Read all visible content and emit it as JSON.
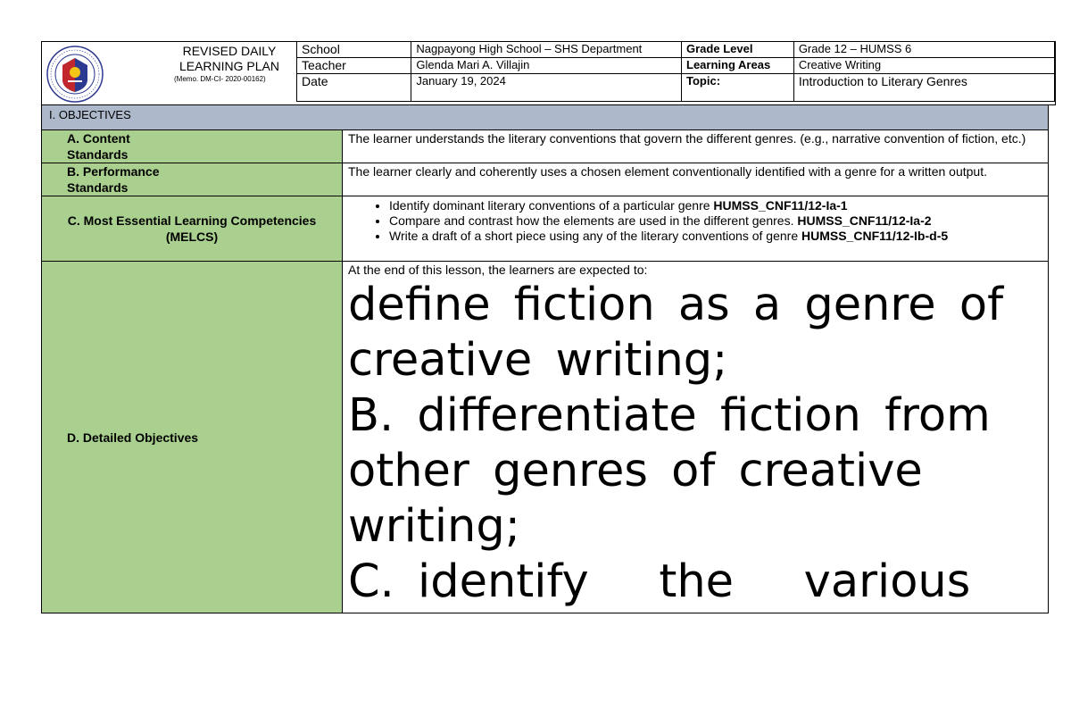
{
  "header": {
    "title_line1": "REVISED DAILY",
    "title_line2": "LEARNING PLAN",
    "memo": "(Memo. DM-CI- 2020-00162)",
    "seal_text": "KAGAWARAN NG EDUKASYON",
    "rows": [
      {
        "label1": "School",
        "value1": "Nagpayong High School – SHS Department",
        "label2": "Grade Level",
        "value2": "Grade 12 – HUMSS 6"
      },
      {
        "label1": "Teacher",
        "value1": "Glenda Mari A. Villajin",
        "label2": "Learning Areas",
        "value2": "Creative Writing"
      },
      {
        "label1": "Date",
        "value1": "January 19, 2024",
        "label2": "Topic:",
        "value2": "Introduction to Literary Genres"
      }
    ]
  },
  "objectives": {
    "heading": "I.  OBJECTIVES",
    "content_label": "A. Content\nStandards",
    "content_text": "The learner understands the literary conventions that govern the different genres. (e.g., narrative convention of fiction, etc.)",
    "performance_label": "B. Performance\nStandards",
    "performance_text": "The learner clearly and coherently uses a chosen element conventionally identified with a genre for a written output.",
    "melcs_label": "C.  Most Essential  Learning Competencies\n(MELCS)",
    "melcs": [
      {
        "text": "Identify dominant literary conventions of a particular genre ",
        "code": "HUMSS_CNF11/12-Ia-1"
      },
      {
        "text": "Compare and contrast how the elements are used in the different genres. ",
        "code": "HUMSS_CNF11/12-Ia-2"
      },
      {
        "text": "Write a draft of a short piece using any of the literary conventions of genre ",
        "code": "HUMSS_CNF11/12-Ib-d-5"
      }
    ],
    "detailed_label": "D. Detailed Objectives",
    "detailed_intro": "At the end of this lesson, the learners are expected to:",
    "detailed_lines": [
      "define fiction as a genre of",
      "creative writing;",
      "B. differentiate fiction from",
      "other genres of creative",
      "writing;",
      "C. identify   the   various"
    ]
  },
  "colors": {
    "green": "#a9d08e",
    "blue_gray": "#adb9ca",
    "seal_blue": "#2b3990",
    "seal_red": "#c1272d"
  }
}
